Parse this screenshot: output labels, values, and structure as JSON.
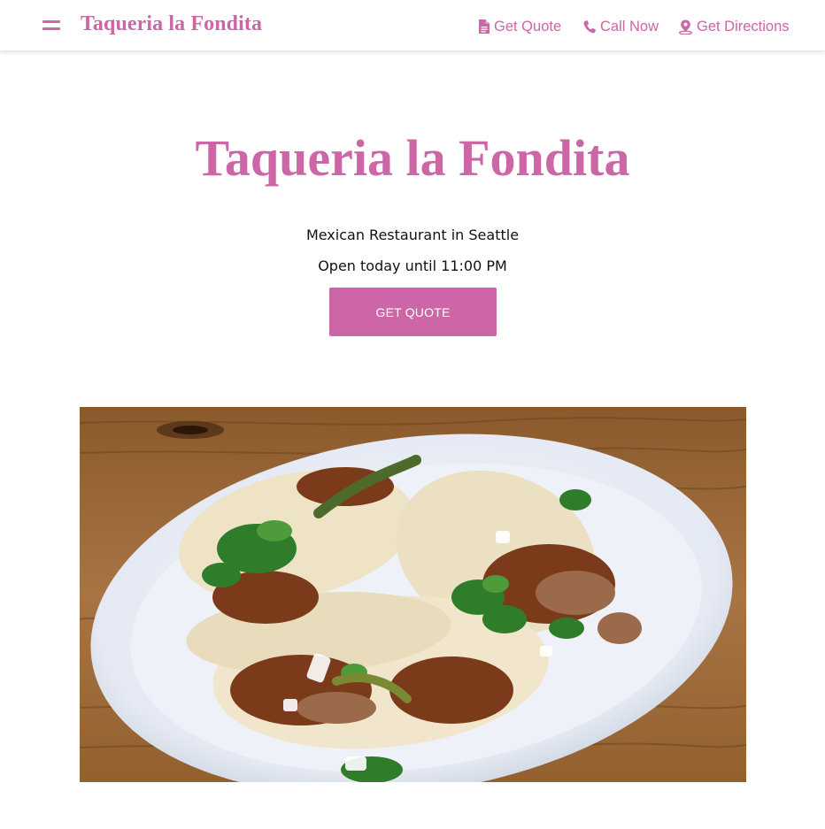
{
  "header": {
    "brand": "Taqueria la Fondita",
    "nav": {
      "quote": {
        "label": "Get Quote",
        "icon": "document-icon"
      },
      "call": {
        "label": "Call Now",
        "icon": "phone-icon"
      },
      "directions": {
        "label": "Get Directions",
        "icon": "map-pin-icon"
      }
    }
  },
  "hero": {
    "title": "Taqueria la Fondita",
    "category_line": "Mexican Restaurant in Seattle",
    "hours_line": "Open today until 11:00 PM",
    "cta_label": "GET QUOTE"
  },
  "colors": {
    "accent": "#cc66a6",
    "text": "#111111",
    "background": "#ffffff"
  }
}
